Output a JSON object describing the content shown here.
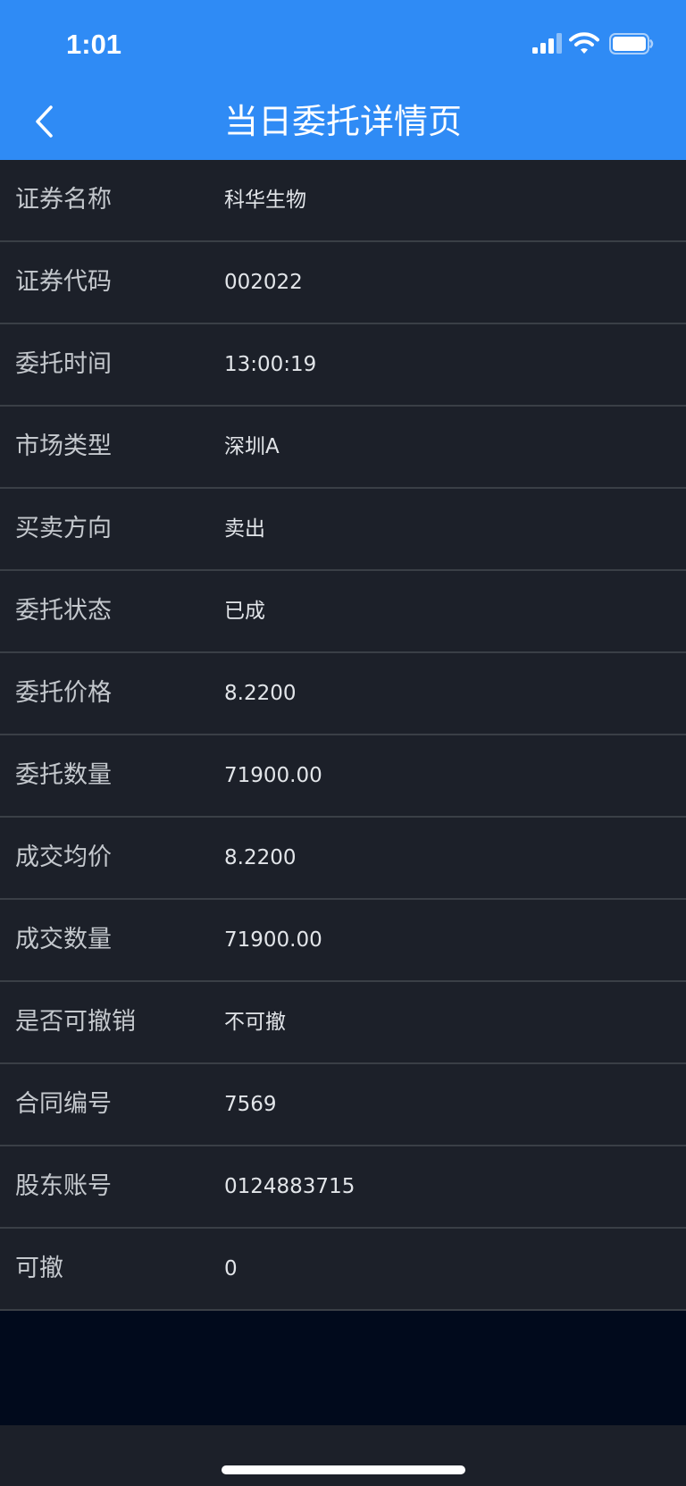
{
  "status_bar": {
    "time": "1:01"
  },
  "nav": {
    "title": "当日委托详情页"
  },
  "details": [
    {
      "label": "证券名称",
      "value": "科华生物"
    },
    {
      "label": "证券代码",
      "value": "002022"
    },
    {
      "label": "委托时间",
      "value": "13:00:19"
    },
    {
      "label": "市场类型",
      "value": "深圳A"
    },
    {
      "label": "买卖方向",
      "value": "卖出"
    },
    {
      "label": "委托状态",
      "value": "已成"
    },
    {
      "label": "委托价格",
      "value": "8.2200"
    },
    {
      "label": "委托数量",
      "value": "71900.00"
    },
    {
      "label": "成交均价",
      "value": "8.2200"
    },
    {
      "label": "成交数量",
      "value": "71900.00"
    },
    {
      "label": "是否可撤销",
      "value": "不可撤"
    },
    {
      "label": "合同编号",
      "value": "7569"
    },
    {
      "label": "股东账号",
      "value": "0124883715"
    },
    {
      "label": "可撤",
      "value": "0"
    }
  ],
  "icons": {
    "back": "chevron-left-icon",
    "signal": "cellular-signal-icon",
    "wifi": "wifi-icon",
    "battery": "battery-icon"
  },
  "colors": {
    "header_bg": "#2f8bf5",
    "row_bg": "#1c2029",
    "divider": "#3a3f46",
    "page_bg": "#010a1c",
    "label_text": "#c4c8cd",
    "value_text": "#e2e5e9"
  }
}
